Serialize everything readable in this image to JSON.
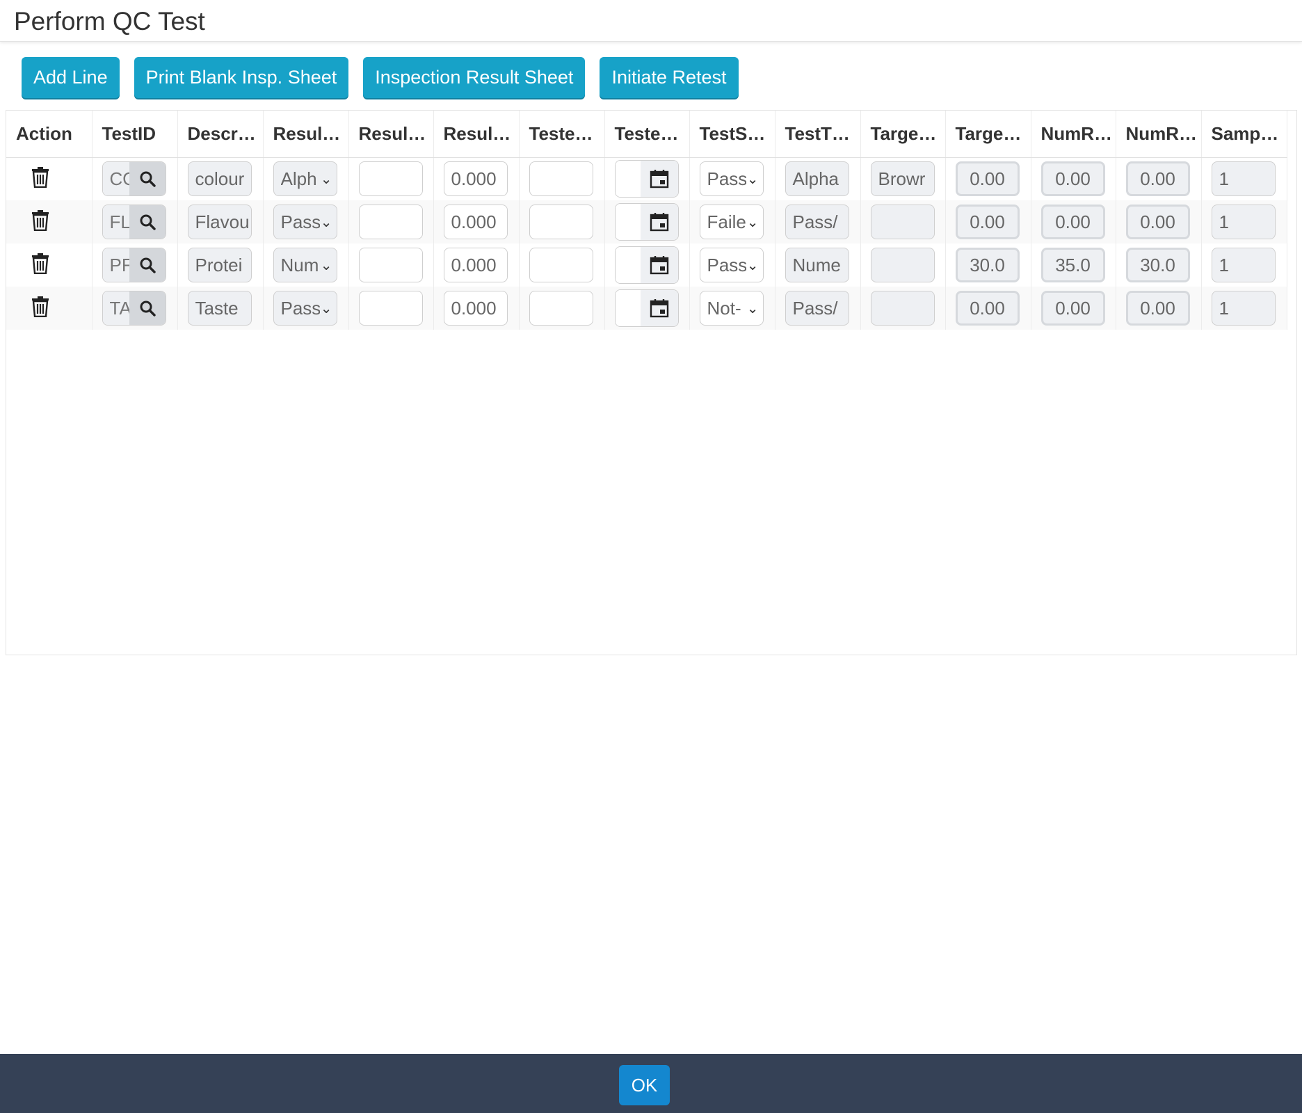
{
  "page": {
    "title": "Perform QC Test"
  },
  "toolbar": {
    "add_line": "Add Line",
    "print_blank": "Print Blank Insp. Sheet",
    "inspection_result": "Inspection Result Sheet",
    "initiate_retest": "Initiate Retest"
  },
  "grid": {
    "columns": [
      "Action",
      "TestID",
      "Descr…",
      "Resul…",
      "Resul…",
      "Resul…",
      "Teste…",
      "Teste…",
      "TestS…",
      "TestT…",
      "Targe…",
      "Targe…",
      "NumR…",
      "NumR…",
      "Samp…"
    ],
    "rows": [
      {
        "test_id": "CO",
        "description": "colour",
        "result_type": "Alph",
        "result_text": "",
        "result_num": "0.000",
        "tested_by": "",
        "test_status": "Pass",
        "test_type": "Alpha",
        "target_text": "Browr",
        "target_num": "0.00",
        "num_range_min": "0.00",
        "num_range_max": "0.00",
        "sample": "1"
      },
      {
        "test_id": "FL",
        "description": "Flavou",
        "result_type": "Pass",
        "result_text": "",
        "result_num": "0.000",
        "tested_by": "",
        "test_status": "Faile",
        "test_type": "Pass/",
        "target_text": "",
        "target_num": "0.00",
        "num_range_min": "0.00",
        "num_range_max": "0.00",
        "sample": "1"
      },
      {
        "test_id": "PF",
        "description": "Protei",
        "result_type": "Num",
        "result_text": "",
        "result_num": "0.000",
        "tested_by": "",
        "test_status": "Pass",
        "test_type": "Nume",
        "target_text": "",
        "target_num": "30.0",
        "num_range_min": "35.0",
        "num_range_max": "30.0",
        "sample": "1"
      },
      {
        "test_id": "TA",
        "description": "Taste",
        "result_type": "Pass",
        "result_text": "",
        "result_num": "0.000",
        "tested_by": "",
        "test_status": "Not-",
        "test_type": "Pass/",
        "target_text": "",
        "target_num": "0.00",
        "num_range_min": "0.00",
        "num_range_max": "0.00",
        "sample": "1"
      }
    ]
  },
  "footer": {
    "ok_label": "OK"
  },
  "icons": {
    "delete": "trash-icon",
    "lookup": "search-icon",
    "date": "calendar-icon",
    "dropdown": "chevron-down-icon"
  },
  "colors": {
    "primary_button": "#17a2c8",
    "footer_bg": "#354156",
    "ok_button": "#1487cf"
  }
}
